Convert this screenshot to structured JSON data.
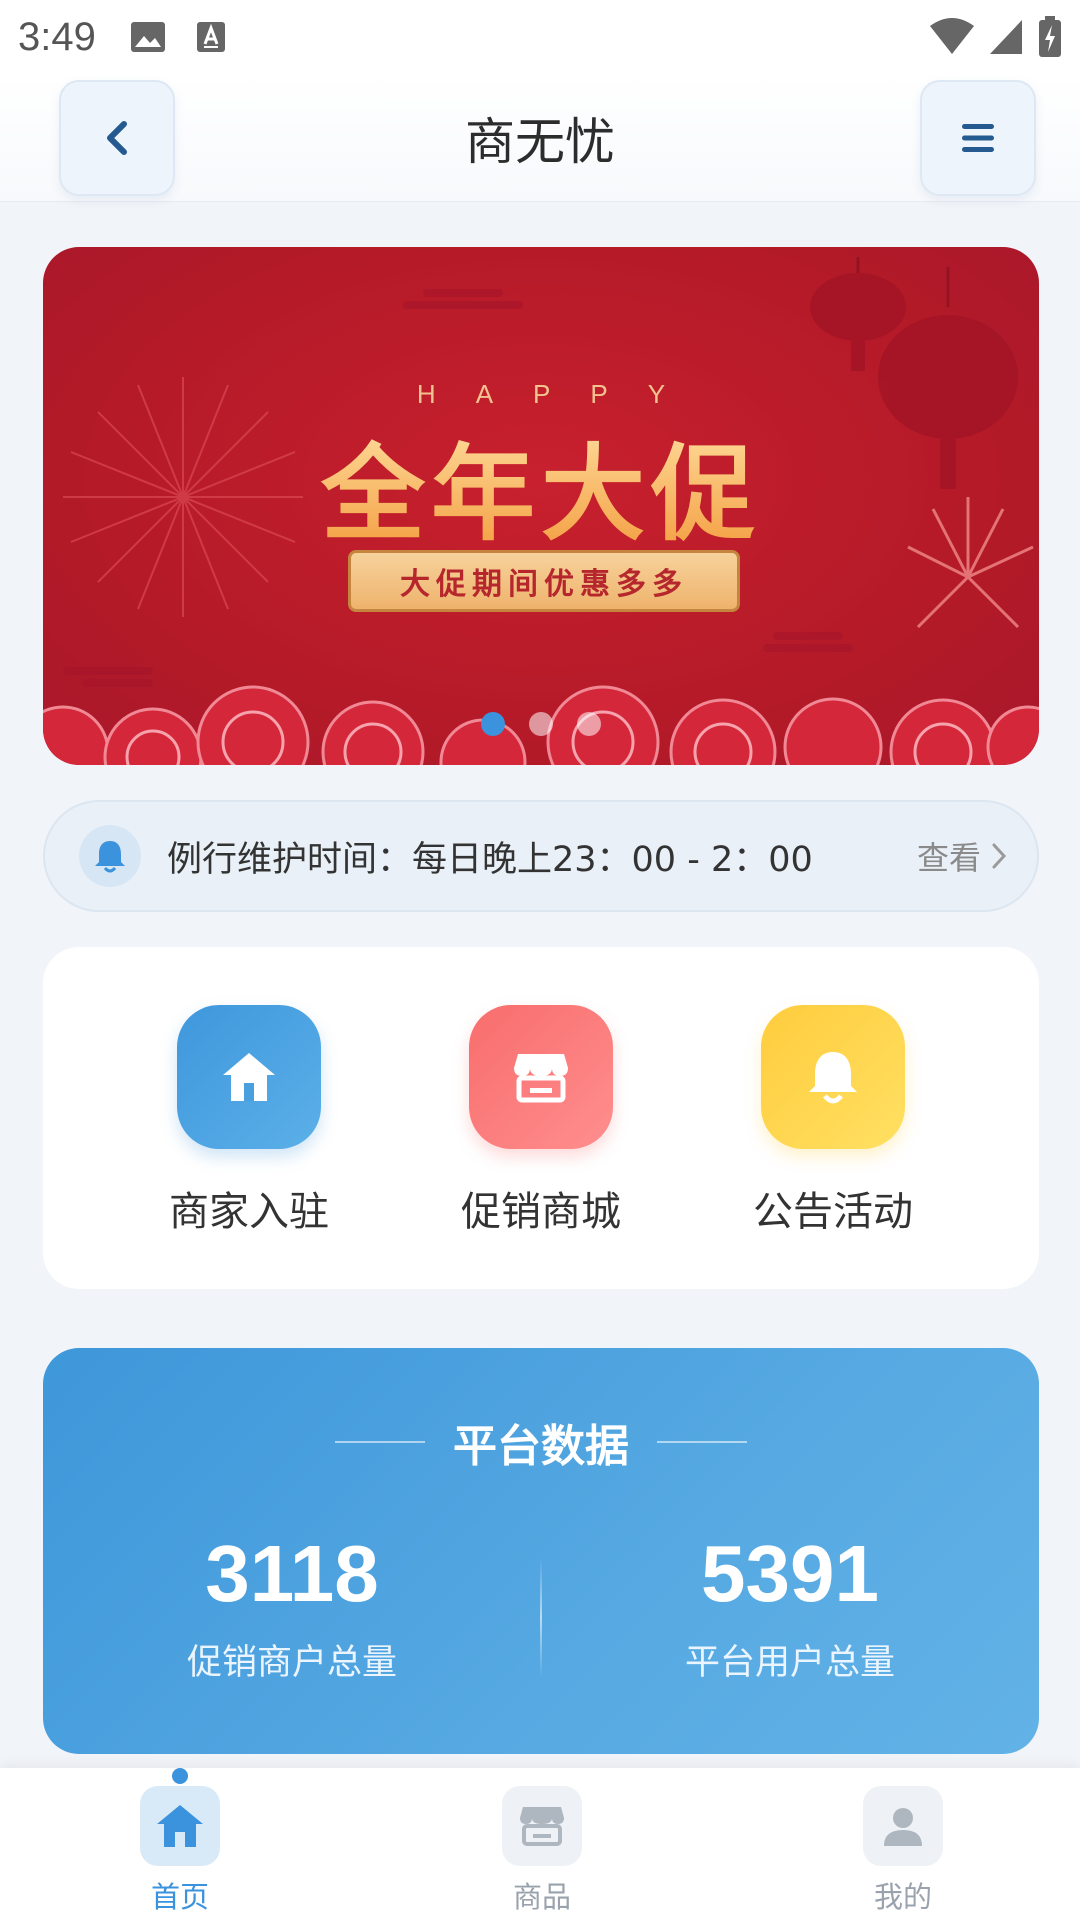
{
  "status_bar": {
    "time": "3:49"
  },
  "header": {
    "title": "商无忧"
  },
  "banner": {
    "happy_text": "HAPPY",
    "headline": "全年大促",
    "subtitle": "大促期间优惠多多",
    "active_slide": 1,
    "slide_count": 3
  },
  "notice": {
    "text": "例行维护时间：每日晚上23：00 - 2：00",
    "more_label": "查看"
  },
  "quick_actions": [
    {
      "label": "商家入驻",
      "icon": "home-icon",
      "color": "#4299dc"
    },
    {
      "label": "促销商城",
      "icon": "store-icon",
      "color": "#f87474"
    },
    {
      "label": "公告活动",
      "icon": "bell-icon",
      "color": "#ffd24a"
    }
  ],
  "stats": {
    "title": "平台数据",
    "items": [
      {
        "value": "3118",
        "label": "促销商户总量"
      },
      {
        "value": "5391",
        "label": "平台用户总量"
      }
    ]
  },
  "tabbar": {
    "items": [
      {
        "label": "首页",
        "icon": "home-icon",
        "active": true
      },
      {
        "label": "商品",
        "icon": "store-icon",
        "active": false
      },
      {
        "label": "我的",
        "icon": "user-icon",
        "active": false
      }
    ]
  },
  "colors": {
    "accent": "#3b92dd",
    "banner_red": "#b81b2a",
    "stats_blue": "#4aa0de"
  }
}
